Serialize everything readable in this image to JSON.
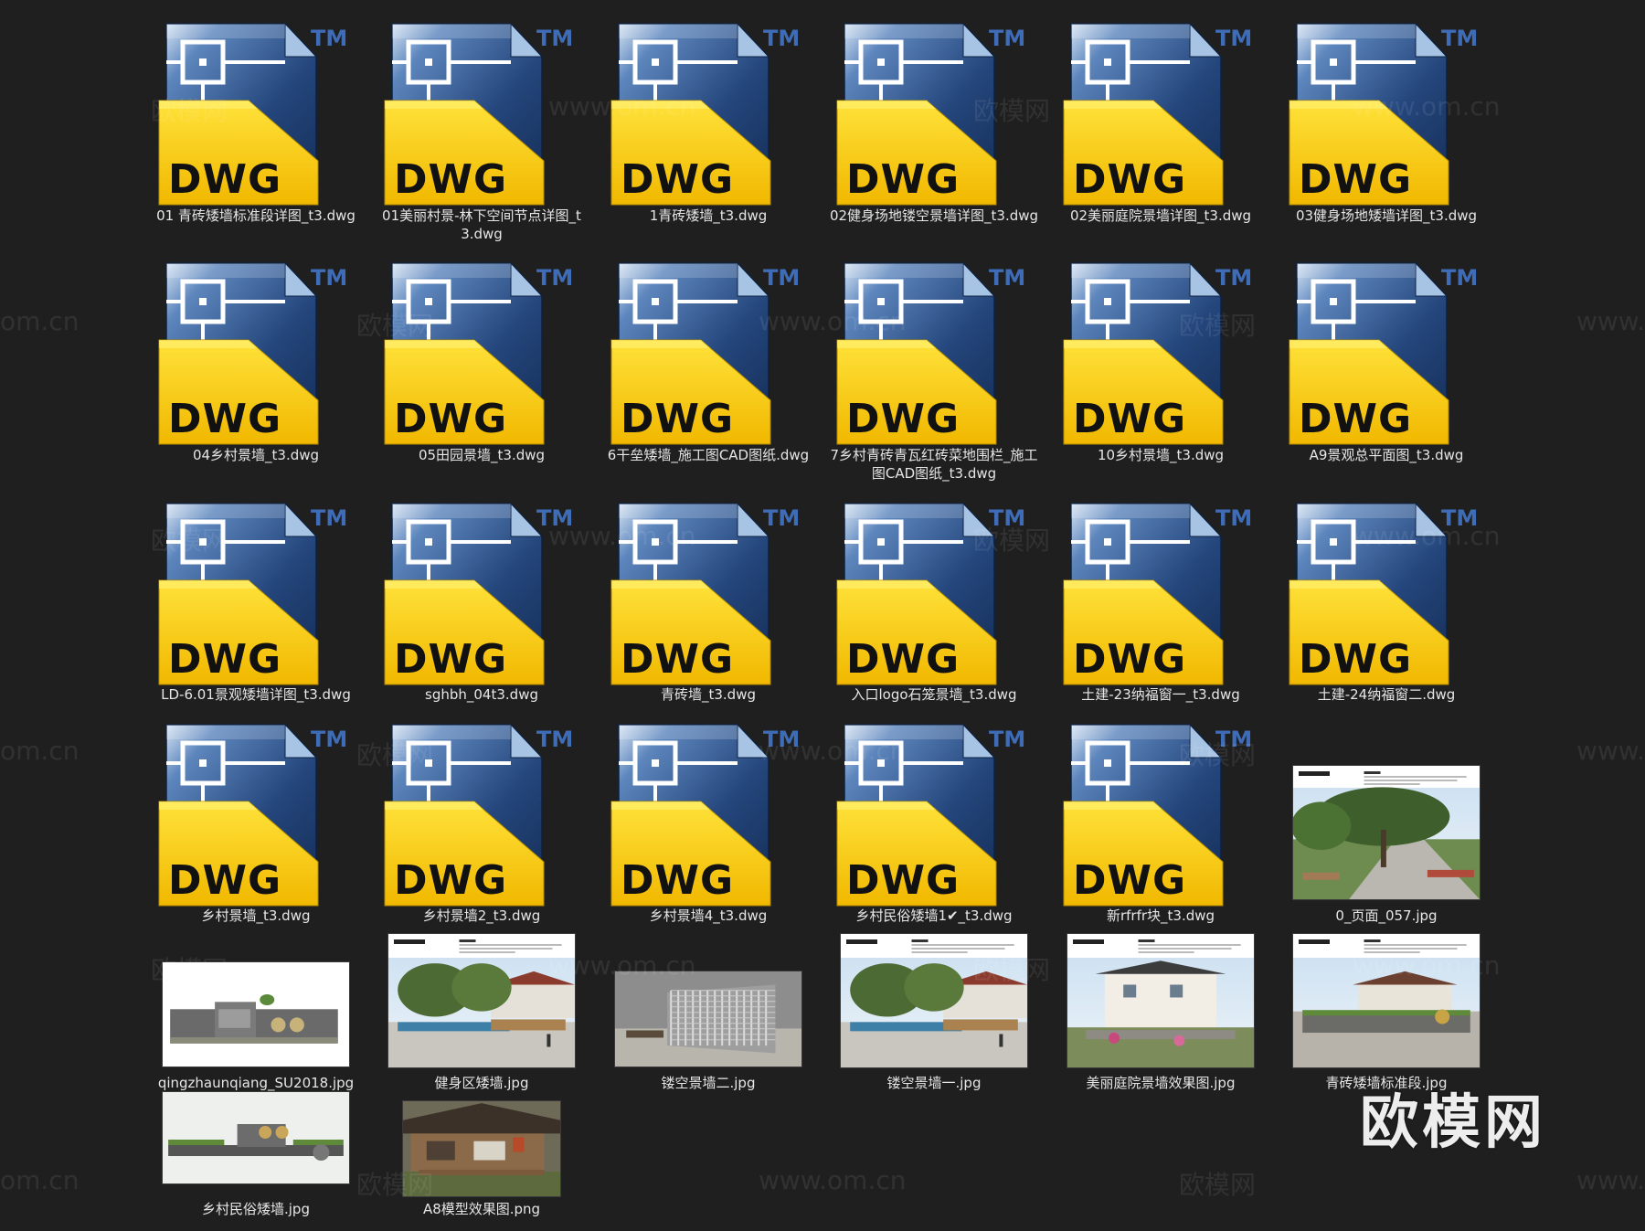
{
  "files": [
    {
      "name": "01 青砖矮墙标准段详图_t3.dwg",
      "type": "dwg"
    },
    {
      "name": "01美丽村景-林下空间节点详图_t3.dwg",
      "type": "dwg"
    },
    {
      "name": "1青砖矮墙_t3.dwg",
      "type": "dwg"
    },
    {
      "name": "02健身场地镂空景墙详图_t3.dwg",
      "type": "dwg"
    },
    {
      "name": "02美丽庭院景墙详图_t3.dwg",
      "type": "dwg"
    },
    {
      "name": "03健身场地矮墙详图_t3.dwg",
      "type": "dwg"
    },
    {
      "name": "04乡村景墙_t3.dwg",
      "type": "dwg"
    },
    {
      "name": "05田园景墙_t3.dwg",
      "type": "dwg"
    },
    {
      "name": "6干垒矮墙_施工图CAD图纸.dwg",
      "type": "dwg"
    },
    {
      "name": "7乡村青砖青瓦红砖菜地围栏_施工图CAD图纸_t3.dwg",
      "type": "dwg"
    },
    {
      "name": "10乡村景墙_t3.dwg",
      "type": "dwg"
    },
    {
      "name": "A9景观总平面图_t3.dwg",
      "type": "dwg"
    },
    {
      "name": "LD-6.01景观矮墙详图_t3.dwg",
      "type": "dwg"
    },
    {
      "name": "sghbh_04t3.dwg",
      "type": "dwg"
    },
    {
      "name": "青砖墙_t3.dwg",
      "type": "dwg"
    },
    {
      "name": "入口logo石笼景墙_t3.dwg",
      "type": "dwg"
    },
    {
      "name": "土建-23纳福窗一_t3.dwg",
      "type": "dwg"
    },
    {
      "name": "土建-24纳福窗二.dwg",
      "type": "dwg"
    },
    {
      "name": "乡村景墙_t3.dwg",
      "type": "dwg"
    },
    {
      "name": "乡村景墙2_t3.dwg",
      "type": "dwg"
    },
    {
      "name": "乡村景墙4_t3.dwg",
      "type": "dwg"
    },
    {
      "name": "乡村民俗矮墙1✔_t3.dwg",
      "type": "dwg"
    },
    {
      "name": "新rfrfr块_t3.dwg",
      "type": "dwg"
    },
    {
      "name": "0_页面_057.jpg",
      "type": "img",
      "thumb": "board-tree"
    },
    {
      "name": "qingzhaunqiang_SU2018.jpg",
      "type": "img",
      "thumb": "wall-model"
    },
    {
      "name": "健身区矮墙.jpg",
      "type": "img",
      "thumb": "board-street"
    },
    {
      "name": "镂空景墙二.jpg",
      "type": "img",
      "thumb": "screen-wall"
    },
    {
      "name": "镂空景墙一.jpg",
      "type": "img",
      "thumb": "board-street"
    },
    {
      "name": "美丽庭院景墙效果图.jpg",
      "type": "img",
      "thumb": "board-house"
    },
    {
      "name": "青砖矮墙标准段.jpg",
      "type": "img",
      "thumb": "board-wall"
    },
    {
      "name": "乡村民俗矮墙.jpg",
      "type": "img",
      "thumb": "wall-model2"
    },
    {
      "name": "A8模型效果图.png",
      "type": "img",
      "thumb": "house-model"
    }
  ],
  "icon": {
    "badge": "DWG",
    "tm": "TM",
    "name": "dwg-file-icon",
    "yellow": "#f4c900",
    "blue": "#1d3c6e"
  },
  "watermarks": [
    "欧模网",
    "www.om.cn",
    "om.cn"
  ],
  "brand": "欧模网"
}
